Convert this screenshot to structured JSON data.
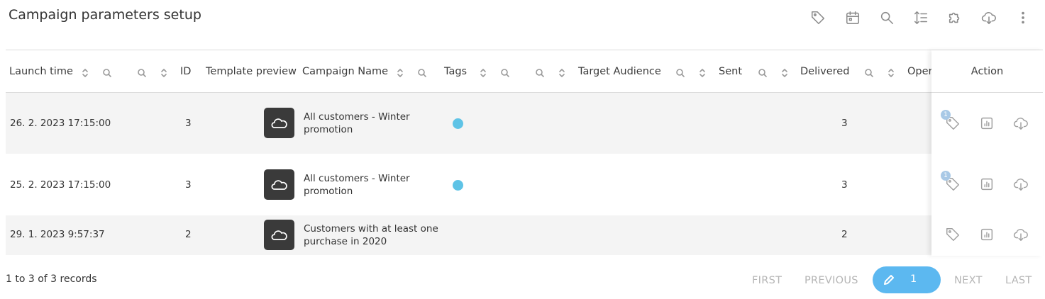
{
  "page": {
    "title": "Campaign parameters setup"
  },
  "toolbar": {
    "icons": [
      "tag-icon",
      "calendar-icon",
      "search-icon",
      "sort-lines-icon",
      "puzzle-icon",
      "cloud-download-icon",
      "more-vert-icon"
    ]
  },
  "columns": {
    "launch_time": "Launch time",
    "id": "ID",
    "template_preview": "Template preview",
    "campaign_name": "Campaign Name",
    "tags": "Tags",
    "target_audience": "Target Audience",
    "sent": "Sent",
    "delivered": "Delivered",
    "opened": "Oper",
    "action": "Action"
  },
  "rows": [
    {
      "launch_time": "26. 2. 2023 17:15:00",
      "id": "3",
      "campaign_name": "All customers - Winter promotion",
      "has_tag": true,
      "delivered": "3",
      "tag_badge": "1"
    },
    {
      "launch_time": "25. 2. 2023 17:15:00",
      "id": "3",
      "campaign_name": "All customers - Winter promotion",
      "has_tag": true,
      "delivered": "3",
      "tag_badge": "1"
    },
    {
      "launch_time": "29. 1. 2023 9:57:37",
      "id": "2",
      "campaign_name": "Customers with at least one purchase in 2020",
      "has_tag": false,
      "delivered": "2",
      "tag_badge": ""
    }
  ],
  "colors": {
    "tag_dot": "#5ec3e6",
    "pager_active": "#5cb8f0",
    "badge": "#a9c9e6"
  },
  "footer": {
    "records": "1 to 3 of 3 records",
    "first": "FIRST",
    "previous": "PREVIOUS",
    "current_page": "1",
    "next": "NEXT",
    "last": "LAST"
  }
}
